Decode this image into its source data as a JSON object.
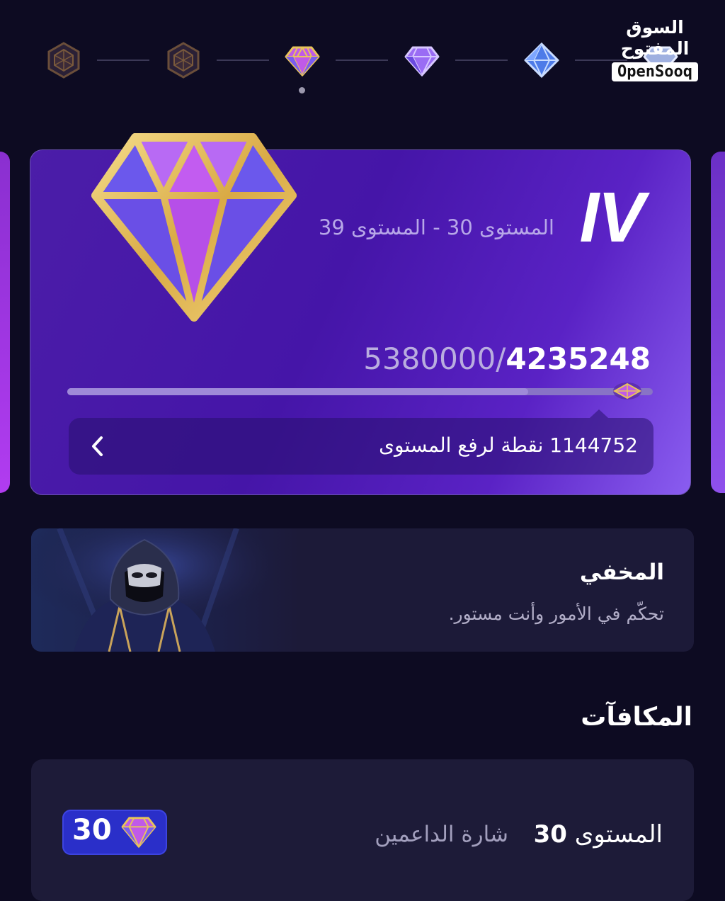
{
  "watermark": {
    "arabic": "السوق المفتوح",
    "latin": "OpenSooq"
  },
  "tiers": [
    {
      "icon": "bronze-gem-icon",
      "state": "past"
    },
    {
      "icon": "bronze-gem-icon",
      "state": "past"
    },
    {
      "icon": "pink-diamond-icon",
      "state": "current"
    },
    {
      "icon": "purple-diamond-icon",
      "state": "next"
    },
    {
      "icon": "blue-diamond-icon",
      "state": "next"
    },
    {
      "icon": "silver-diamond-icon",
      "state": "next"
    }
  ],
  "level_card": {
    "tier_numeral": "IV",
    "level_range": "المستوى 30 - المستوى 39",
    "points_current": "4235248",
    "points_max": "5380000",
    "progress_fraction": 0.787,
    "remaining_text": "1144752 نقطة لرفع المستوى",
    "gem_icon": "gold-purple-diamond-icon"
  },
  "persona": {
    "title": "المخفي",
    "description": "تحكّم في الأمور وأنت مستور.",
    "image": "masked-hooded-figure"
  },
  "rewards": {
    "heading": "المكافآت",
    "items": [
      {
        "level_label": "المستوى",
        "level_number": "30",
        "name": "شارة الداعمين",
        "badge_number": "30",
        "badge_icon": "pink-diamond-icon"
      }
    ]
  },
  "colors": {
    "background": "#0d0b22",
    "card_purple": "#4b1da8",
    "persona_card": "#1c1a38",
    "badge_blue": "#2a2fc9",
    "gold": "#e8c45a"
  }
}
